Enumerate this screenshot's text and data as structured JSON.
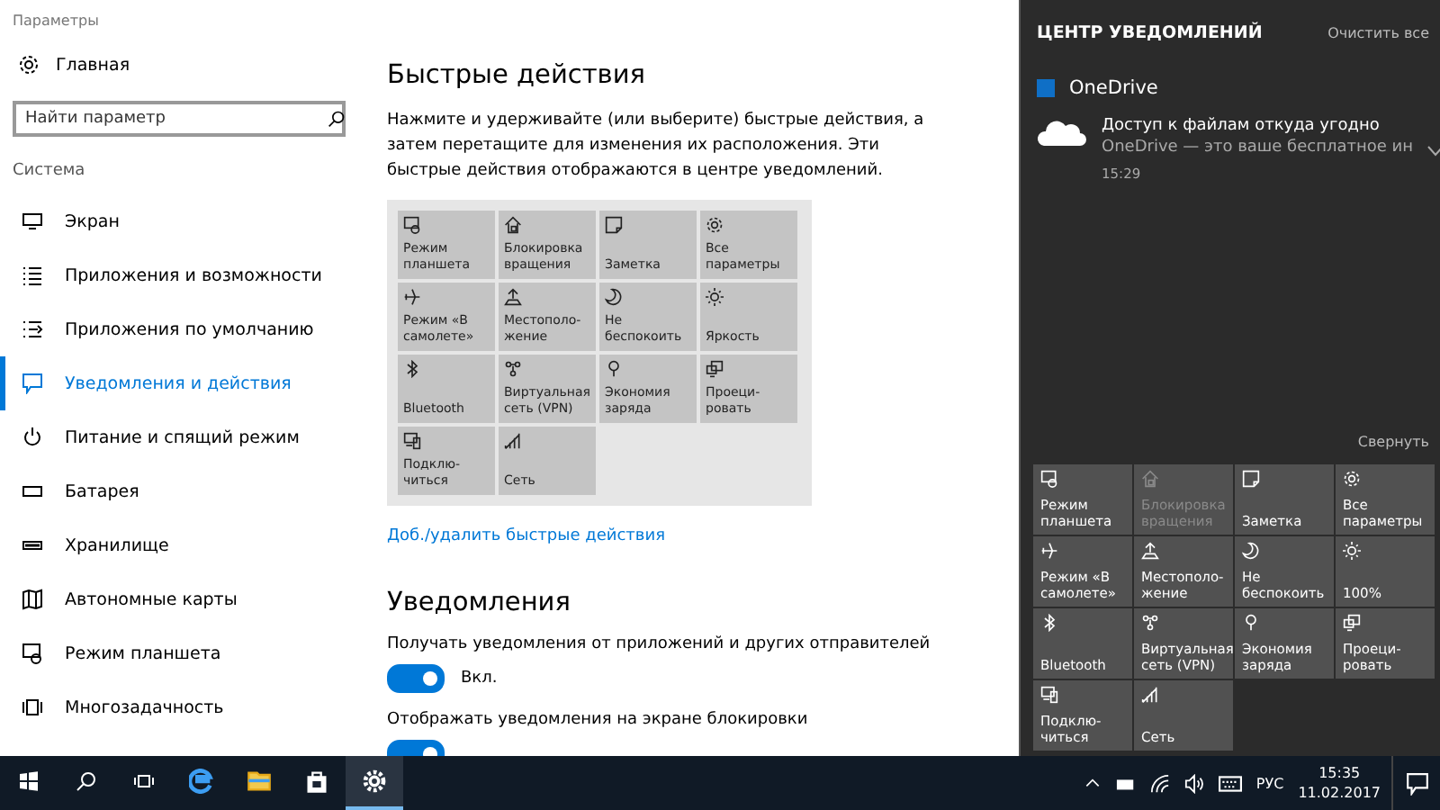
{
  "window": {
    "title": "Параметры"
  },
  "sidebar": {
    "home": "Главная",
    "search": {
      "placeholder": "Найти параметр"
    },
    "section": "Система",
    "items": [
      {
        "label": "Экран",
        "selected": false
      },
      {
        "label": "Приложения и возможности",
        "selected": false
      },
      {
        "label": "Приложения по умолчанию",
        "selected": false
      },
      {
        "label": "Уведомления и действия",
        "selected": true
      },
      {
        "label": "Питание и спящий режим",
        "selected": false
      },
      {
        "label": "Батарея",
        "selected": false
      },
      {
        "label": "Хранилище",
        "selected": false
      },
      {
        "label": "Автономные карты",
        "selected": false
      },
      {
        "label": "Режим планшета",
        "selected": false
      },
      {
        "label": "Многозадачность",
        "selected": false
      }
    ]
  },
  "quick_actions": {
    "title": "Быстрые действия",
    "description": "Нажмите и удерживайте (или выберите) быстрые действия, а затем перетащите для изменения их расположения. Эти быстрые действия отображаются в центре уведомлений.",
    "tiles": [
      {
        "label": "Режим\nпланшета"
      },
      {
        "label": "Блокировка\nвращения"
      },
      {
        "label": "Заметка"
      },
      {
        "label": "Все\nпараметры"
      },
      {
        "label": "Режим «В\nсамолете»"
      },
      {
        "label": "Местополо-\nжение"
      },
      {
        "label": "Не\nбеспокоить"
      },
      {
        "label": "Яркость"
      },
      {
        "label": "Bluetooth"
      },
      {
        "label": "Виртуальная\nсеть (VPN)"
      },
      {
        "label": "Экономия\nзаряда"
      },
      {
        "label": "Проеци-\nровать"
      },
      {
        "label": "Подклю-\nчиться"
      },
      {
        "label": "Сеть"
      }
    ],
    "link": "Доб./удалить быстрые действия"
  },
  "notifications": {
    "title": "Уведомления",
    "settings": [
      {
        "label": "Получать уведомления от приложений и других отправителей",
        "on": true,
        "state_text": "Вкл."
      },
      {
        "label": "Отображать уведомления на экране блокировки",
        "on": true
      }
    ]
  },
  "action_center": {
    "title": "ЦЕНТР УВЕДОМЛЕНИЙ",
    "clear_all": "Очистить все",
    "app": "OneDrive",
    "notification": {
      "title": "Доступ к файлам откуда угодно",
      "body": "OneDrive — это ваше бесплатное ин",
      "time": "15:29"
    },
    "collapse": "Свернуть",
    "tiles": [
      {
        "label": "Режим\nпланшета",
        "disabled": false
      },
      {
        "label": "Блокировка\nвращения",
        "disabled": true
      },
      {
        "label": "Заметка",
        "disabled": false
      },
      {
        "label": "Все\nпараметры",
        "disabled": false
      },
      {
        "label": "Режим «В\nсамолете»",
        "disabled": false
      },
      {
        "label": "Местополо-\nжение",
        "disabled": false
      },
      {
        "label": "Не\nбеспокоить",
        "disabled": false
      },
      {
        "label": "100%",
        "disabled": false
      },
      {
        "label": "Bluetooth",
        "disabled": false
      },
      {
        "label": "Виртуальная\nсеть (VPN)",
        "disabled": false
      },
      {
        "label": "Экономия\nзаряда",
        "disabled": false
      },
      {
        "label": "Проеци-\nровать",
        "disabled": false
      },
      {
        "label": "Подклю-\nчиться",
        "disabled": false
      },
      {
        "label": "Сеть",
        "disabled": false
      }
    ]
  },
  "taskbar": {
    "apps": [
      {
        "running": false
      },
      {
        "running": false
      },
      {
        "running": false
      },
      {
        "running": true
      }
    ],
    "language": "РУС",
    "time": "15:35",
    "date": "11.02.2017"
  }
}
